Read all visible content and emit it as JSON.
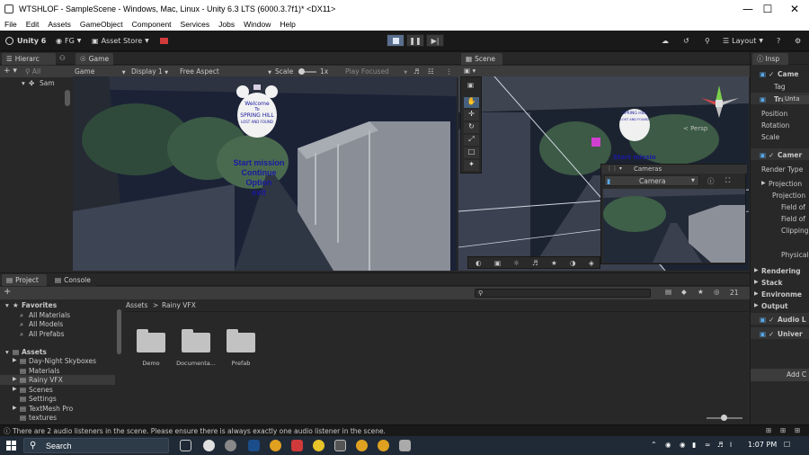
{
  "window": {
    "title": "WTSHLOF - SampleScene - Windows, Mac, Linux - Unity 6.3 LTS (6000.3.7f1)* <DX11>",
    "minimize": "—",
    "maximize": "☐",
    "close": "✕"
  },
  "menu": [
    "File",
    "Edit",
    "Assets",
    "GameObject",
    "Component",
    "Services",
    "Jobs",
    "Window",
    "Help"
  ],
  "toolbar": {
    "unity_label": "Unity 6",
    "account": "FG",
    "asset_store": "Asset Store",
    "layout": "Layout"
  },
  "hierarchy": {
    "tab": "Hierarc",
    "search": "All",
    "scene_item": "Sam"
  },
  "game": {
    "tab": "Game",
    "mode": "Game",
    "display": "Display 1",
    "aspect": "Free Aspect",
    "scale_label": "Scale",
    "scale_value": "1x",
    "play_focused": "Play Focused",
    "sign_title": "Welcome",
    "sign_to": "To",
    "sign_name": "SPRING HILL",
    "sign_sub": "LOST AND FOUND",
    "menu_items": [
      "Start mission",
      "Continue",
      "Option",
      "exit"
    ]
  },
  "scene": {
    "tab": "Scene",
    "persp": "< Persp",
    "sign_name": "SPRING HILL",
    "sign_sub": "LOST AND FOUND",
    "menu_top": "Start missio",
    "menu_bottom": "Continue",
    "cameras_title": "Cameras",
    "cameras_select": "Camera"
  },
  "inspector": {
    "tab": "Insp",
    "object_name": "Came",
    "tag_label": "Tag",
    "tag_value": "Unta",
    "transform": "Transfo",
    "position": "Position",
    "rotation": "Rotation",
    "scale": "Scale",
    "camera": "Camer",
    "render_type": "Render Type",
    "projection_header": "Projection",
    "projection": "Projection",
    "field_of_1": "Field of",
    "field_of_2": "Field of",
    "clipping": "Clipping",
    "physical": "Physical",
    "rendering": "Rendering",
    "stack": "Stack",
    "environment": "Environme",
    "output": "Output",
    "audio": "Audio L",
    "universal": "Univer",
    "add_component": "Add C"
  },
  "project": {
    "tab_project": "Project",
    "tab_console": "Console",
    "favorites": "Favorites",
    "fav_items": [
      "All Materials",
      "All Models",
      "All Prefabs"
    ],
    "assets": "Assets",
    "asset_items": [
      "Day-Night Skyboxes",
      "Materials",
      "Rainy VFX",
      "Scenes",
      "Settings",
      "TextMesh Pro",
      "textures"
    ],
    "breadcrumb_root": "Assets",
    "breadcrumb_sep": ">",
    "breadcrumb_current": "Rainy VFX",
    "folders": [
      "Demo",
      "Documenta...",
      "Prefab"
    ],
    "count": "21"
  },
  "status": {
    "message": "There are 2 audio listeners in the scene. Please ensure there is always exactly one audio listener in the scene."
  },
  "taskbar": {
    "search": "Search",
    "time": "1:07 PM"
  },
  "colors": {
    "accent": "#3d7fd1",
    "game_text": "#1a1aa0",
    "editor_bg": "#282828",
    "stop_red": "#d23b3b"
  }
}
